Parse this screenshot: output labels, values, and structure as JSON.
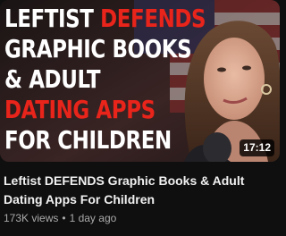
{
  "thumbnail": {
    "headline": [
      [
        {
          "text": "LEFTIST ",
          "color": "white"
        },
        {
          "text": "DEFENDS",
          "color": "red"
        }
      ],
      [
        {
          "text": "GRAPHIC BOOKS",
          "color": "white"
        }
      ],
      [
        {
          "text": "& ADULT",
          "color": "white"
        }
      ],
      [
        {
          "text": "DATING APPS",
          "color": "red"
        }
      ],
      [
        {
          "text": "FOR CHILDREN",
          "color": "white"
        }
      ]
    ],
    "duration": "17:12",
    "colors": {
      "headline_white": "#ffffff",
      "headline_red": "#e8241b"
    }
  },
  "video": {
    "title": "Leftist DEFENDS Graphic Books & Adult Dating Apps For Children",
    "views": "173K views",
    "separator": "•",
    "age": "1 day ago"
  }
}
